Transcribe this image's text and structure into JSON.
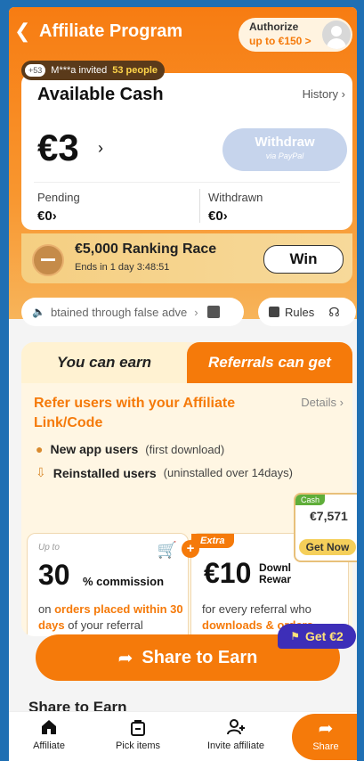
{
  "header": {
    "title": "Affiliate Program",
    "authorize_line1": "Authorize",
    "authorize_line2": "up to €150 >"
  },
  "invite": {
    "badge": "+53",
    "text": "M***a invited",
    "count": "53 people"
  },
  "cash": {
    "title": "Available Cash",
    "history": "History",
    "amount": "€3",
    "withdraw_label": "Withdraw",
    "withdraw_via": "via PayPal",
    "pending_label": "Pending",
    "pending_value": "€0",
    "withdrawn_label": "Withdrawn",
    "withdrawn_value": "€0"
  },
  "race": {
    "title": "€5,000 Ranking Race",
    "subtitle": "Ends in 1 day 3:48:51",
    "button": "Win"
  },
  "notice": {
    "text": "btained through false adve"
  },
  "rules": {
    "label": "Rules"
  },
  "earn": {
    "tab_left": "You can earn",
    "tab_right": "Referrals can get",
    "refer_text": "Refer users with your Affiliate Link/Code",
    "details": "Details",
    "new_users_bold": "New app users",
    "new_users_note": "(first download)",
    "reinstalled_bold": "Reinstalled users",
    "reinstalled_note": "(uninstalled over 14days)",
    "commission": {
      "upto": "Up to",
      "percent": "30",
      "unit": "% commission",
      "desc_prefix": "on",
      "desc_highlight": "orders placed within 30 days",
      "desc_suffix": "of your referral downloading the app"
    },
    "extra": {
      "tag": "Extra",
      "amount": "€10",
      "reward_line1": "Downl",
      "reward_line2": "Rewar",
      "desc": "for every referral who",
      "desc_highlight": "downloads & orders"
    },
    "cash_float": {
      "label": "Cash",
      "amount": "€7,571",
      "button": "Get Now"
    }
  },
  "promo": {
    "get2": "Get €2"
  },
  "share": {
    "button": "Share to Earn",
    "section_title": "Share to Earn"
  },
  "tabbar": {
    "affiliate": "Affiliate",
    "pick_items": "Pick items",
    "invite_affiliate": "Invite affiliate",
    "share": "Share"
  }
}
